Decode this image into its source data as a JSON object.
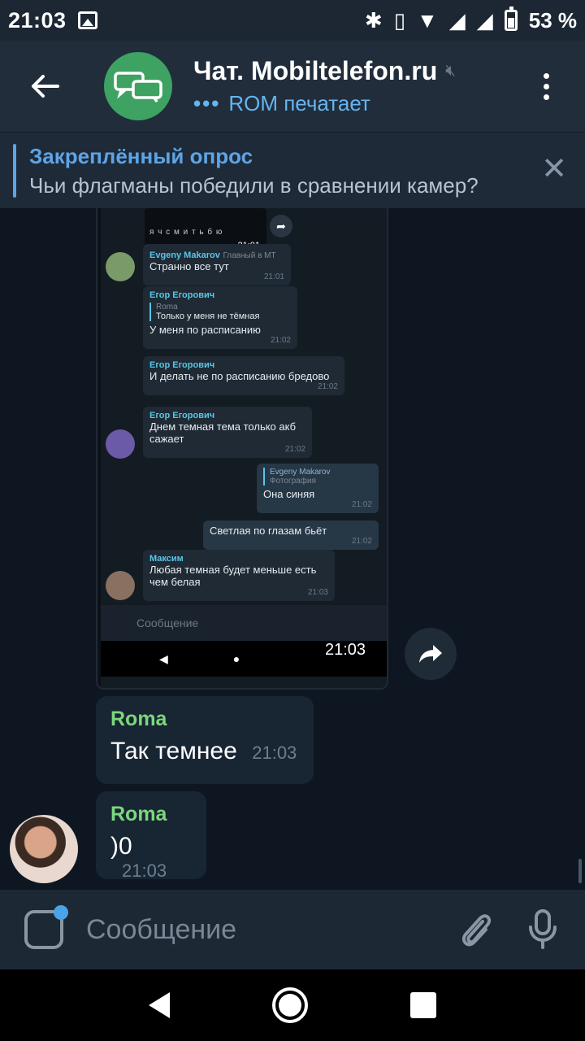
{
  "status_bar": {
    "time": "21:03",
    "battery": "53 %"
  },
  "header": {
    "title": "Чат. Mobiltelefon.ru",
    "typing_dots": "•••",
    "subtitle": "ROM печатает"
  },
  "pinned": {
    "title": "Закреплённый опрос",
    "text": "Чьи флагманы победили в сравнении камер?"
  },
  "photo_message": {
    "time": "21:03",
    "keyboard_letters": "я ч с м и т ь б ю",
    "keyboard_time": "21:01",
    "input_placeholder": "Сообщение",
    "inner_messages": [
      {
        "sender": "Evgeny Makarov",
        "role": "Главный в МТ",
        "text": "Странно все тут",
        "time": "21:01"
      },
      {
        "sender": "Егор Егорович",
        "reply_name": "Roma",
        "reply_text": "Только у меня не тёмная",
        "text": "У меня по расписанию",
        "time": "21:02"
      },
      {
        "sender": "Егор Егорович",
        "text": "И делать не по расписанию бредово",
        "time": "21:02"
      },
      {
        "sender": "Егор Егорович",
        "text": "Днем темная тема только акб сажает",
        "time": "21:02"
      },
      {
        "reply_name": "Evgeny Makarov",
        "reply_text": "Фотография",
        "text": "Она синяя",
        "time": "21:02"
      },
      {
        "text": "Светлая по глазам бьёт",
        "time": "21:02"
      },
      {
        "sender": "Максим",
        "text": "Любая темная будет меньше есть чем белая",
        "time": "21:03"
      }
    ]
  },
  "messages": [
    {
      "sender": "Roma",
      "text": "Так темнее",
      "time": "21:03"
    },
    {
      "sender": "Roma",
      "text": ")0",
      "time": "21:03"
    }
  ],
  "input": {
    "placeholder": "Сообщение"
  }
}
